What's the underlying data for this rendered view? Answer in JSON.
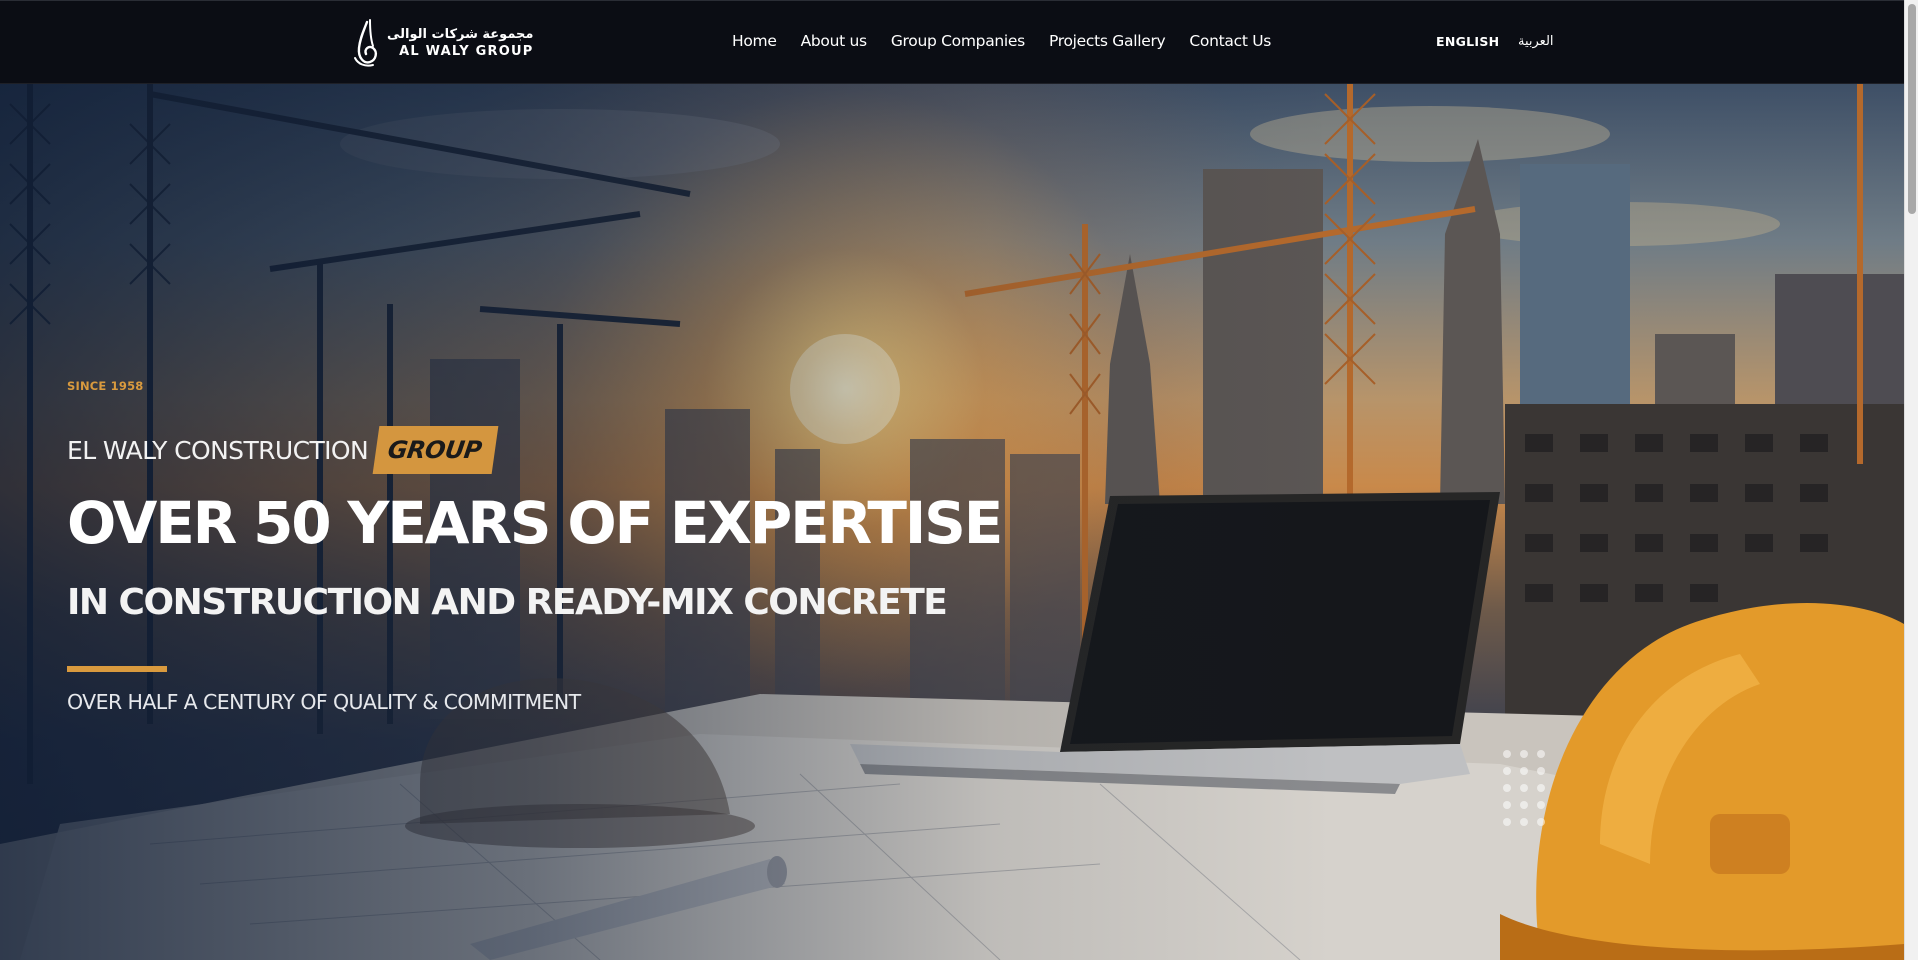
{
  "header": {
    "logo": {
      "arabic_name": "مجموعة شركات الوالى",
      "english_name": "AL WALY GROUP",
      "icon": "calligraphy-logo-icon"
    },
    "nav": [
      {
        "label": "Home"
      },
      {
        "label": "About us"
      },
      {
        "label": "Group Companies"
      },
      {
        "label": "Projects Gallery"
      },
      {
        "label": "Contact Us"
      }
    ],
    "languages": {
      "english": "ENGLISH",
      "arabic": "العربية"
    }
  },
  "hero": {
    "since": "SINCE 1958",
    "brand_name": "EL WALY CONSTRUCTION",
    "brand_badge": "GROUP",
    "headline": "OVER 50 YEARS OF EXPERTISE",
    "subhead": "IN CONSTRUCTION AND READY-MIX CONCRETE",
    "tagline": "OVER HALF A CENTURY OF QUALITY & COMMITMENT",
    "background_image": "construction site at sunset with cranes, laptop and hard hats"
  },
  "colors": {
    "header_bg": "#0b0d14",
    "accent": "#d99a3e",
    "text": "#ffffff"
  }
}
